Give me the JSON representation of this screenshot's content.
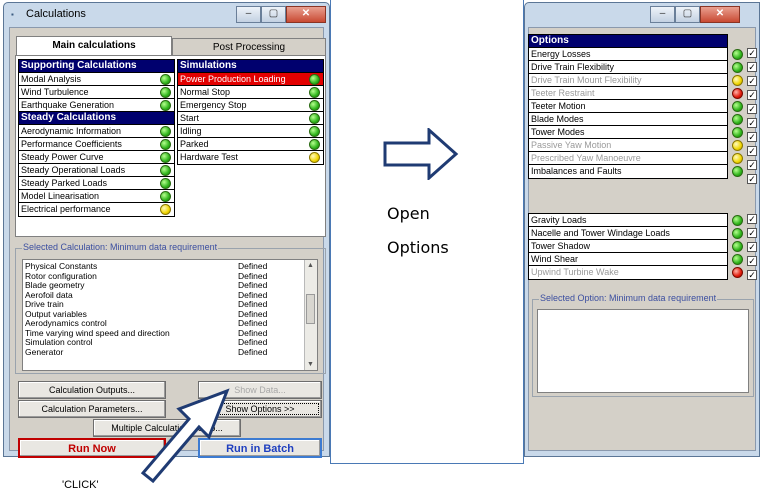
{
  "left_window": {
    "title": "Calculations",
    "controls": {
      "minimize": "–",
      "maximize": "▢",
      "close": "✕"
    },
    "tabs": [
      {
        "label": "Main calculations"
      },
      {
        "label": "Post Processing"
      }
    ],
    "supporting": {
      "header": "Supporting Calculations",
      "items": [
        {
          "label": "Modal Analysis",
          "status": "green"
        },
        {
          "label": "Wind Turbulence",
          "status": "green"
        },
        {
          "label": "Earthquake Generation",
          "status": "green"
        }
      ]
    },
    "steady": {
      "header": "Steady Calculations",
      "items": [
        {
          "label": "Aerodynamic Information",
          "status": "green"
        },
        {
          "label": "Performance Coefficients",
          "status": "green"
        },
        {
          "label": "Steady Power Curve",
          "status": "green"
        },
        {
          "label": "Steady Operational Loads",
          "status": "green"
        },
        {
          "label": "Steady Parked Loads",
          "status": "green"
        },
        {
          "label": "Model Linearisation",
          "status": "green"
        },
        {
          "label": "Electrical performance",
          "status": "yellow"
        }
      ]
    },
    "simulations": {
      "header": "Simulations",
      "items": [
        {
          "label": "Power Production Loading",
          "status": "green",
          "selected": true
        },
        {
          "label": "Normal Stop",
          "status": "green"
        },
        {
          "label": "Emergency Stop",
          "status": "green"
        },
        {
          "label": "Start",
          "status": "green"
        },
        {
          "label": "Idling",
          "status": "green"
        },
        {
          "label": "Parked",
          "status": "green"
        },
        {
          "label": "Hardware Test",
          "status": "yellow"
        }
      ]
    },
    "selected_group_label": "Selected Calculation: Minimum data requirement",
    "requirements": [
      {
        "name": "Physical Constants",
        "state": "Defined"
      },
      {
        "name": "Rotor configuration",
        "state": "Defined"
      },
      {
        "name": "Blade geometry",
        "state": "Defined"
      },
      {
        "name": "Aerofoil data",
        "state": "Defined"
      },
      {
        "name": "Drive train",
        "state": "Defined"
      },
      {
        "name": "Output variables",
        "state": "Defined"
      },
      {
        "name": "Aerodynamics control",
        "state": "Defined"
      },
      {
        "name": "Time varying wind speed and direction",
        "state": "Defined"
      },
      {
        "name": "Simulation control",
        "state": "Defined"
      },
      {
        "name": "Generator",
        "state": "Defined"
      }
    ],
    "buttons": {
      "calc_outputs": "Calculation Outputs...",
      "show_data": "Show Data...",
      "calc_params": "Calculation Parameters...",
      "show_options": "Show Options >>",
      "multiple": "Multiple Calculation Setup...",
      "run_now": "Run Now",
      "run_batch": "Run in Batch"
    }
  },
  "annotations": {
    "open_line1": "Open",
    "open_line2": "Options",
    "click": "'CLICK'"
  },
  "right_window": {
    "controls": {
      "minimize": "–",
      "maximize": "▢",
      "close": "✕"
    },
    "options_header": "Options",
    "options": [
      {
        "label": "Energy Losses",
        "status": "green",
        "enabled": true
      },
      {
        "label": "Drive Train Flexibility",
        "status": "green",
        "enabled": true
      },
      {
        "label": "Drive Train Mount Flexibility",
        "status": "yellow",
        "enabled": false
      },
      {
        "label": "Teeter Restraint",
        "status": "red",
        "enabled": false
      },
      {
        "label": "Teeter Motion",
        "status": "green",
        "enabled": true
      },
      {
        "label": "Blade Modes",
        "status": "green",
        "enabled": true
      },
      {
        "label": "Tower Modes",
        "status": "green",
        "enabled": true
      },
      {
        "label": "Passive Yaw Motion",
        "status": "yellow",
        "enabled": false
      },
      {
        "label": "Prescribed Yaw Manoeuvre",
        "status": "yellow",
        "enabled": false
      },
      {
        "label": "Imbalances and Faults",
        "status": "green",
        "enabled": true
      }
    ],
    "loads": [
      {
        "label": "Gravity Loads",
        "status": "green",
        "enabled": true
      },
      {
        "label": "Nacelle and Tower Windage Loads",
        "status": "green",
        "enabled": true
      },
      {
        "label": "Tower Shadow",
        "status": "green",
        "enabled": true
      },
      {
        "label": "Wind Shear",
        "status": "green",
        "enabled": true
      },
      {
        "label": "Upwind Turbine Wake",
        "status": "red",
        "enabled": false
      }
    ],
    "selected_option_label": "Selected Option: Minimum data requirement"
  },
  "colors": {
    "header_bg": "#00006e",
    "selected_bg": "#e30000",
    "run_now": "#c00000",
    "run_batch": "#1f3fbf",
    "arrow": "#1f3b73"
  }
}
